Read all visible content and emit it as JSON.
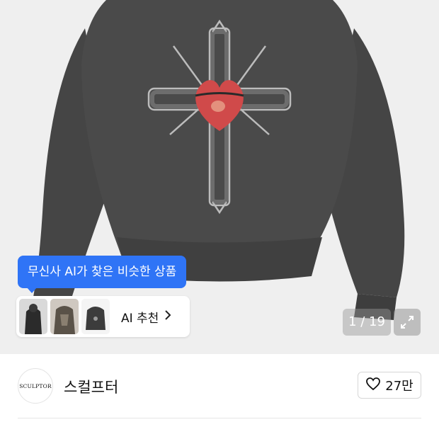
{
  "product_image": {
    "description_icon": "hoodie-cross-heart-graphic",
    "colors": {
      "background": "#efefef",
      "garment": "#474747",
      "heart": "#d04a4a"
    }
  },
  "ai_recommendation": {
    "tooltip": "무신사 AI가 찾은 비슷한 상품",
    "button_label": "AI 추천",
    "chevron_icon": "chevron-right-icon",
    "accent_color": "#2f74f6"
  },
  "gallery": {
    "counter": "1 / 19",
    "expand_icon": "expand-icon"
  },
  "brand": {
    "logo_text": "SCULPTOR",
    "name": "스컬프터"
  },
  "like": {
    "icon": "heart-outline-icon",
    "count": "27만"
  }
}
